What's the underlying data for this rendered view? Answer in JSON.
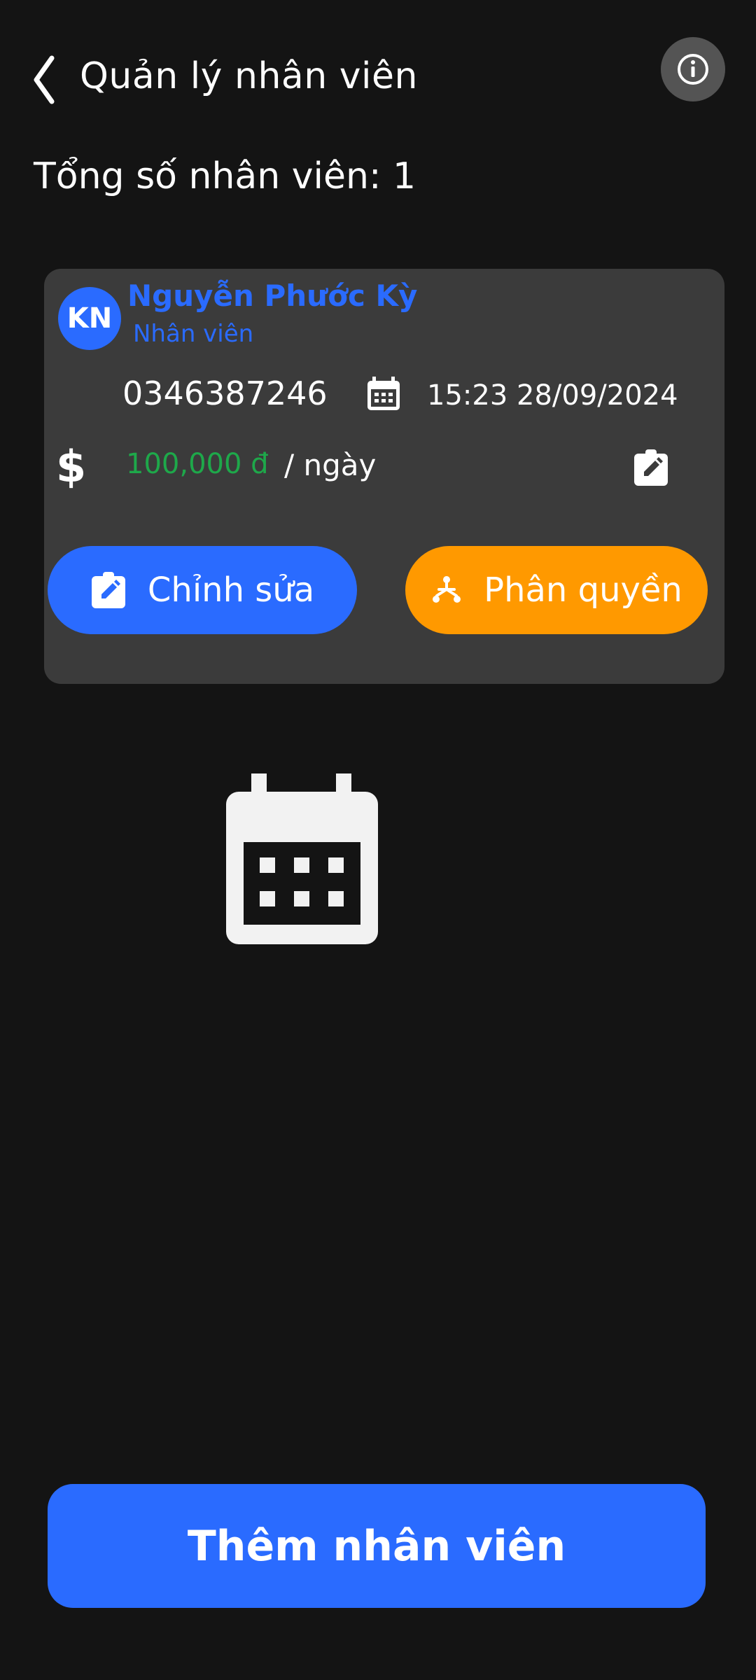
{
  "header": {
    "title": "Quản lý nhân viên",
    "back_icon": "chevron-left-icon",
    "info_icon": "info-icon"
  },
  "summary": {
    "label": "Tổng số nhân viên: ",
    "count": "1"
  },
  "employee": {
    "initials": "KN",
    "name": "Nguyễn Phước Kỳ",
    "role": "Nhân viên",
    "phone": "0346387246",
    "datetime": "15:23 28/09/2024",
    "currency_symbol": "$",
    "salary": "100,000 đ",
    "salary_unit": "/ ngày"
  },
  "actions": {
    "edit_label": "Chỉnh sửa",
    "permission_label": "Phân quyền"
  },
  "footer": {
    "add_label": "Thêm nhân viên"
  },
  "colors": {
    "background": "#141414",
    "card": "#3b3b3b",
    "primary": "#2a6bff",
    "accent_orange": "#ff9900",
    "salary_green": "#1ea84a"
  }
}
